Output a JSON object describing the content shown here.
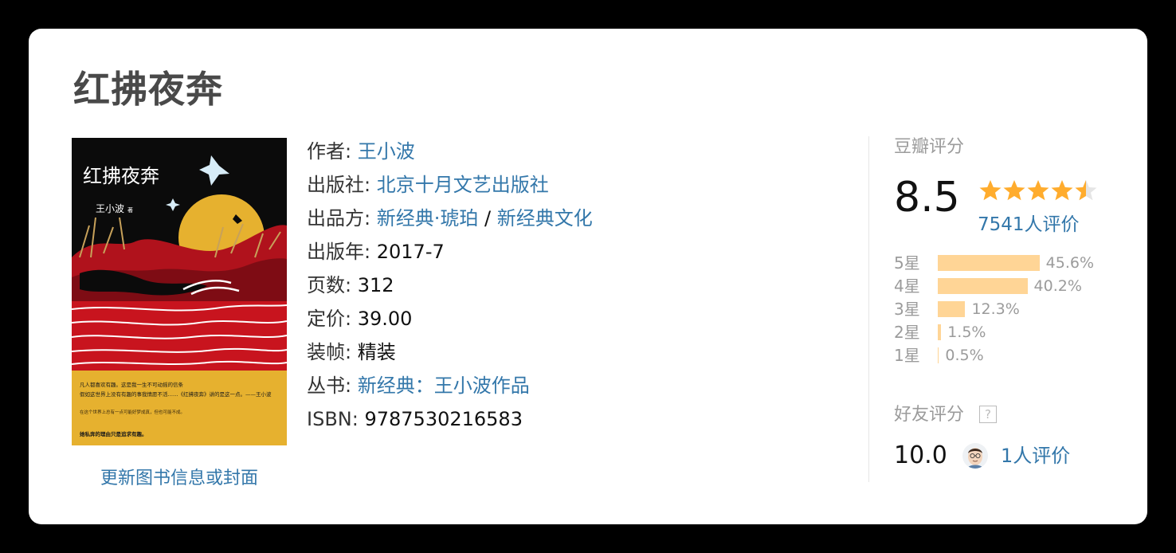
{
  "book": {
    "title": "红拂夜奔",
    "cover": {
      "title_text": "红拂夜奔",
      "author_text": "王小波",
      "author_suffix": "著",
      "blurb_line1": "凡人都喜欢有趣。这是我一生不可动摇的信条",
      "blurb_line2": "假如这世界上没有有趣的事我情愿不活……《红拂夜奔》讲的是这一点。——王小波",
      "blurb_line3": "在这个世界上总有一点可能好梦成真，但也可能不成。",
      "blurb_line4": "她私奔的理由只是追求有趣。",
      "colors": {
        "black": "#0b0b0b",
        "red": "#c8141e",
        "gold": "#e6b12f",
        "white": "#ffffff"
      }
    },
    "update_link": "更新图书信息或封面",
    "info": {
      "author_label": "作者:",
      "author": "王小波",
      "publisher_label": "出版社:",
      "publisher": "北京十月文艺出版社",
      "producer_label": "出品方:",
      "producer_1": "新经典·琥珀",
      "producer_sep": "/",
      "producer_2": "新经典文化",
      "year_label": "出版年:",
      "year": "2017-7",
      "pages_label": "页数:",
      "pages": "312",
      "price_label": "定价:",
      "price": "39.00",
      "binding_label": "装帧:",
      "binding": "精装",
      "series_label": "丛书:",
      "series": "新经典：王小波作品",
      "isbn_label": "ISBN:",
      "isbn": "9787530216583"
    }
  },
  "rating": {
    "title": "豆瓣评分",
    "score": "8.5",
    "stars": 4.5,
    "count": "7541人评价",
    "star_color": "#ffac2d",
    "distribution": [
      {
        "label": "5星",
        "pct": "45.6%",
        "value": 45.6
      },
      {
        "label": "4星",
        "pct": "40.2%",
        "value": 40.2
      },
      {
        "label": "3星",
        "pct": "12.3%",
        "value": 12.3
      },
      {
        "label": "2星",
        "pct": "1.5%",
        "value": 1.5
      },
      {
        "label": "1星",
        "pct": "0.5%",
        "value": 0.5
      }
    ],
    "friends_title": "好友评分",
    "friends_help": "?",
    "friends_score": "10.0",
    "friends_count": "1人评价",
    "bar_color": "#ffd596"
  }
}
